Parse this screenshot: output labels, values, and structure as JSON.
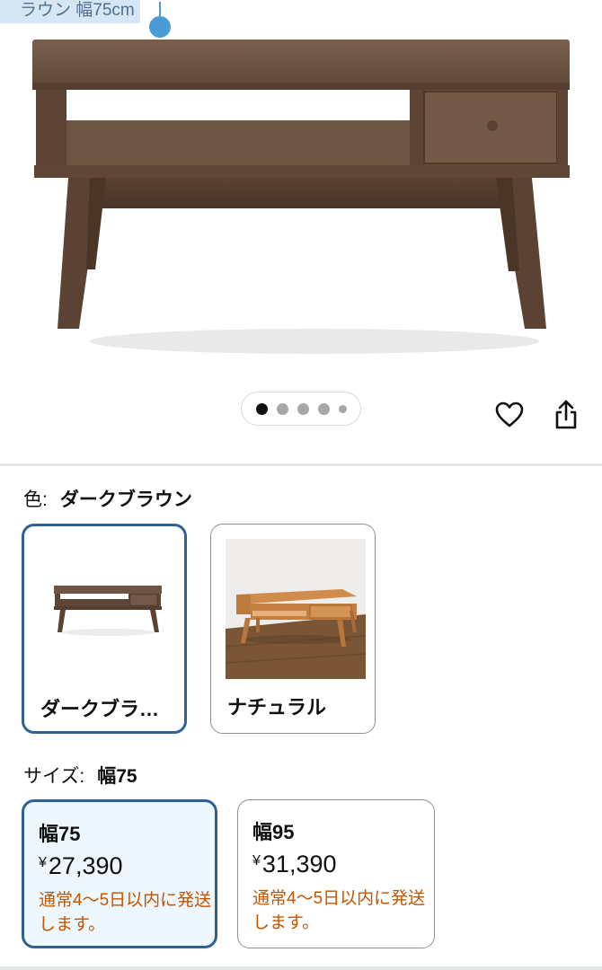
{
  "selection": {
    "text": "ラウン 幅75cm"
  },
  "gallery": {
    "dots": 5,
    "active_index": 0
  },
  "color": {
    "label": "色:",
    "selected": "ダークブラウン",
    "options": [
      {
        "name": "ダークブラ…",
        "selected": true
      },
      {
        "name": "ナチュラル",
        "selected": false
      }
    ]
  },
  "size": {
    "label": "サイズ:",
    "selected": "幅75",
    "options": [
      {
        "name": "幅75",
        "currency": "¥",
        "price": "27,390",
        "shipping": "通常4～5日以内に発送します。",
        "selected": true
      },
      {
        "name": "幅95",
        "currency": "¥",
        "price": "31,390",
        "shipping": "通常4～5日以内に発送します。",
        "selected": false
      }
    ]
  },
  "colors": {
    "accent": "#2f6096",
    "shipping_text": "#c45500",
    "selected_bg": "#edf7fd"
  },
  "icons": {
    "wishlist": "heart-icon",
    "share": "share-icon"
  }
}
